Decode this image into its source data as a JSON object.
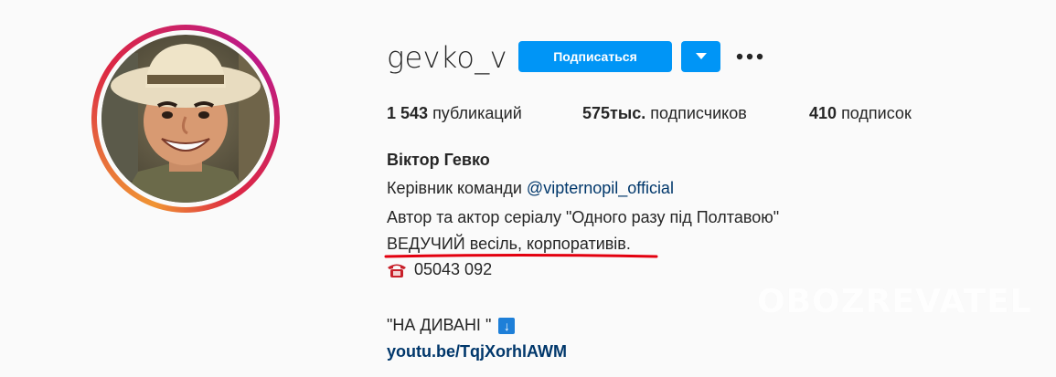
{
  "profile": {
    "username": "gevko_v",
    "follow_label": "Подписаться",
    "more_label": "•••"
  },
  "stats": {
    "posts_count": "1 543",
    "posts_label": "публикаций",
    "followers_count": "575тыс.",
    "followers_label": "подписчиков",
    "following_count": "410",
    "following_label": "подписок"
  },
  "bio": {
    "name": "Віктор Гевко",
    "line1_prefix": "Керівник команди ",
    "line1_mention": "@vipternopil_official",
    "line2": "Автор та актор серіалу \"Одного разу під Полтавою\"",
    "line3": "ВЕДУЧИЙ весіль, корпоративів.",
    "phone": "05043  092",
    "line5": "\"НА ДИВАНІ \"",
    "line5_emoji": "↓",
    "link": "youtu.be/TqjXorhlAWM"
  },
  "watermark": {
    "text": "OBOZREVATEL"
  },
  "colors": {
    "button_blue": "#0095f6",
    "link_blue": "#00376b",
    "underline_red": "#e3000f"
  },
  "icons": {
    "phone": "telephone-icon",
    "dropdown": "chevron-down-icon",
    "more": "more-horizontal-icon",
    "arrow": "down-arrow-emoji-icon"
  }
}
